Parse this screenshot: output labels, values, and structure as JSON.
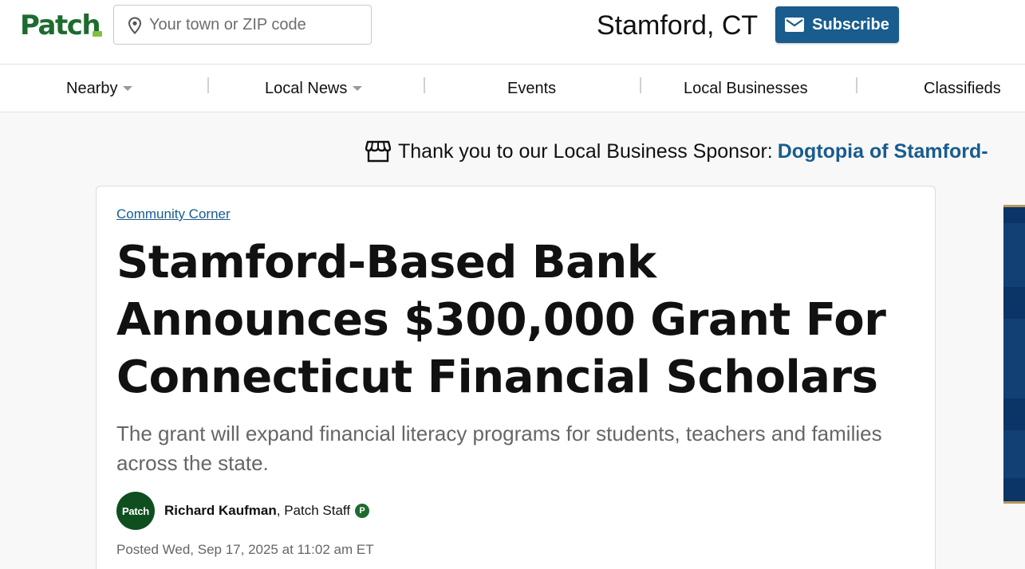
{
  "header": {
    "logo_text": "Patch",
    "search": {
      "placeholder": "Your town or ZIP code",
      "value": ""
    },
    "town": "Stamford, CT",
    "subscribe_label": "Subscribe"
  },
  "nav": {
    "items": [
      {
        "label": "Nearby",
        "has_dropdown": true
      },
      {
        "label": "Local News",
        "has_dropdown": true
      },
      {
        "label": "Events",
        "has_dropdown": false
      },
      {
        "label": "Local Businesses",
        "has_dropdown": false
      },
      {
        "label": "Classifieds",
        "has_dropdown": false
      }
    ]
  },
  "sponsor": {
    "prefix": "Thank you to our Local Business Sponsor:",
    "name": "Dogtopia of Stamford-"
  },
  "article": {
    "category": "Community Corner",
    "headline": "Stamford-Based Bank Announces $300,000 Grant For Connecticut Financial Scholars",
    "deck": "The grant will expand financial literacy programs for students, teachers and families across the state.",
    "author": {
      "avatar_text": "Patch",
      "name": "Richard Kaufman",
      "role": ", Patch Staff",
      "badge": "P"
    },
    "posted": "Posted Wed, Sep 17, 2025 at 11:02 am ET"
  },
  "colors": {
    "brand_green": "#1e6b2f",
    "link_blue": "#195c8e",
    "subscribe_bg": "#195c8e"
  }
}
